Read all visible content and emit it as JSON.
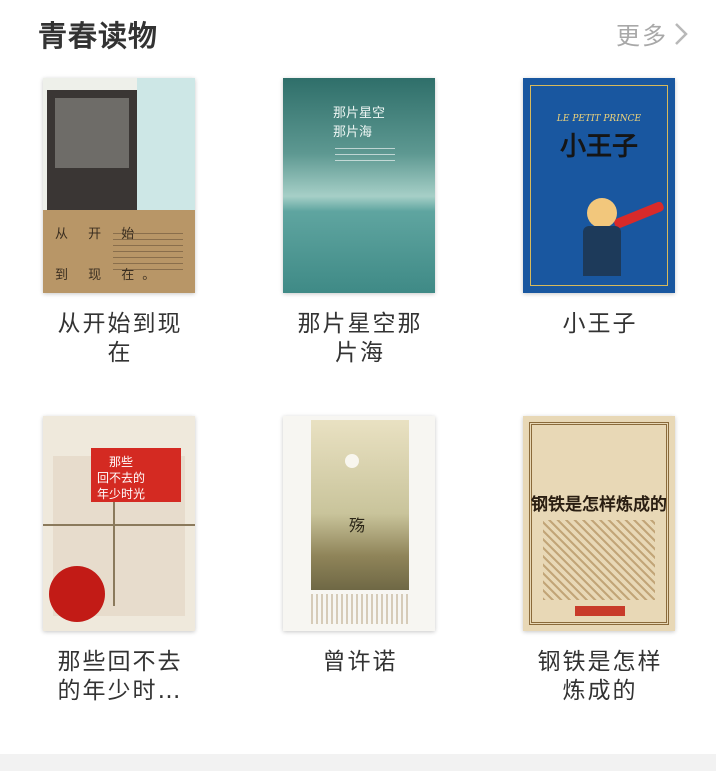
{
  "section": {
    "title": "青春读物",
    "more_label": "更多"
  },
  "books": [
    {
      "title": "从开始到现在",
      "cover_line1": "从 开 始",
      "cover_line2": "到 现 在。"
    },
    {
      "title": "那片星空那片海",
      "cover_text": "那片星空\n那片海"
    },
    {
      "title": "小王子",
      "cover_en": "LE PETIT PRINCE",
      "cover_zh": "小王子"
    },
    {
      "title": "那些回不去的年少时…",
      "cover_text": "那些\n回不去的\n年少时光"
    },
    {
      "title": "曾许诺",
      "cover_text": "殇"
    },
    {
      "title": "钢铁是怎样炼成的",
      "cover_text": "钢铁是怎样炼成的"
    }
  ],
  "colors": {
    "title": "#333333",
    "more": "#a8a8a8",
    "footer": "#f2f2f2"
  }
}
